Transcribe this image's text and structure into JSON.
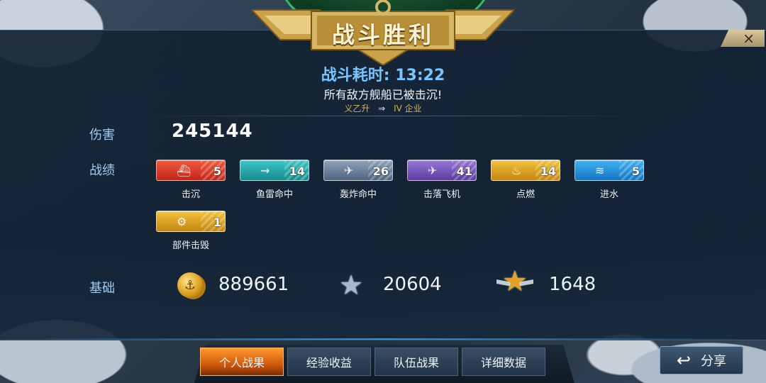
{
  "header": {
    "title": "战斗胜利",
    "close_icon": "×"
  },
  "summary": {
    "time_label": "战斗耗时:",
    "time_value": "13:22",
    "message": "所有敌方舰船已被击沉!",
    "mvp_player": "义乙升",
    "mvp_arrow": "⇒",
    "mvp_tier": "IV",
    "mvp_ship": "企业"
  },
  "damage": {
    "label": "伤害",
    "value": "245144"
  },
  "medals": {
    "label": "战绩",
    "items": [
      {
        "name": "击沉",
        "count": "5",
        "icon": "ship-sinking-icon",
        "color": "#e0402d"
      },
      {
        "name": "鱼雷命中",
        "count": "14",
        "icon": "torpedo-icon",
        "color": "#26a7aa"
      },
      {
        "name": "轰炸命中",
        "count": "26",
        "icon": "bomb-icon",
        "color": "#6f84a0"
      },
      {
        "name": "击落飞机",
        "count": "41",
        "icon": "plane-icon",
        "color": "#7a58bc"
      },
      {
        "name": "点燃",
        "count": "14",
        "icon": "fire-icon",
        "color": "#dca223"
      },
      {
        "name": "进水",
        "count": "5",
        "icon": "flood-icon",
        "color": "#2a94dc"
      },
      {
        "name": "部件击毁",
        "count": "1",
        "icon": "gear-icon",
        "color": "#dca223"
      }
    ]
  },
  "base": {
    "label": "基础",
    "credits": "889661",
    "xp": "20604",
    "commander_xp": "1648"
  },
  "tabs": [
    "个人战果",
    "经验收益",
    "队伍战果",
    "详细数据"
  ],
  "active_tab": 0,
  "share_label": "分享"
}
